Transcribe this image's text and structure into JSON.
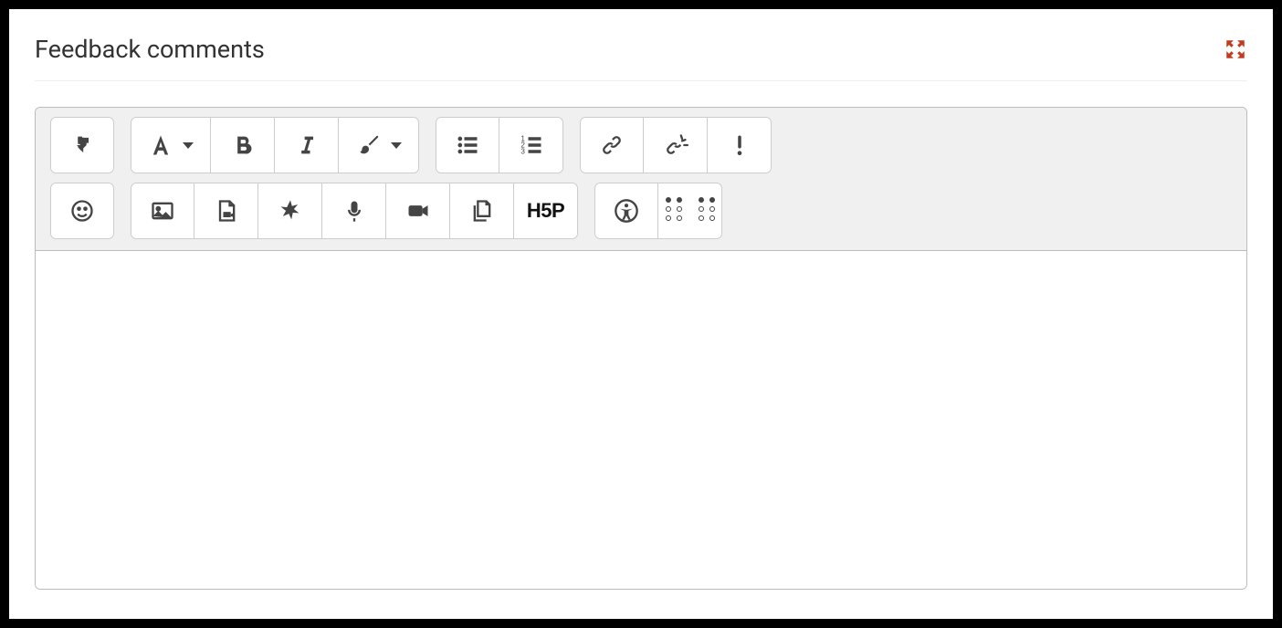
{
  "header": {
    "title": "Feedback comments"
  },
  "toolbar": {
    "row1": {
      "toggle_toolbar": "Show/hide advanced buttons",
      "paragraph_styles": "Paragraph styles",
      "bold": "Bold",
      "italic": "Italic",
      "text_color": "Font colour",
      "ul": "Unordered list",
      "ol": "Ordered list",
      "link": "Link",
      "unlink": "Unlink",
      "important": "Important"
    },
    "row2": {
      "emoji": "Emoji picker",
      "image": "Insert image",
      "media_file": "Insert media file",
      "loading": "Manage files",
      "mic": "Record audio",
      "video": "Record video",
      "files": "Manage files",
      "h5p": "H5P",
      "a11y": "Accessibility checker",
      "grid": "Screenreader helper"
    }
  },
  "editor": {
    "content": ""
  },
  "actions": {
    "expand": "Expand"
  }
}
